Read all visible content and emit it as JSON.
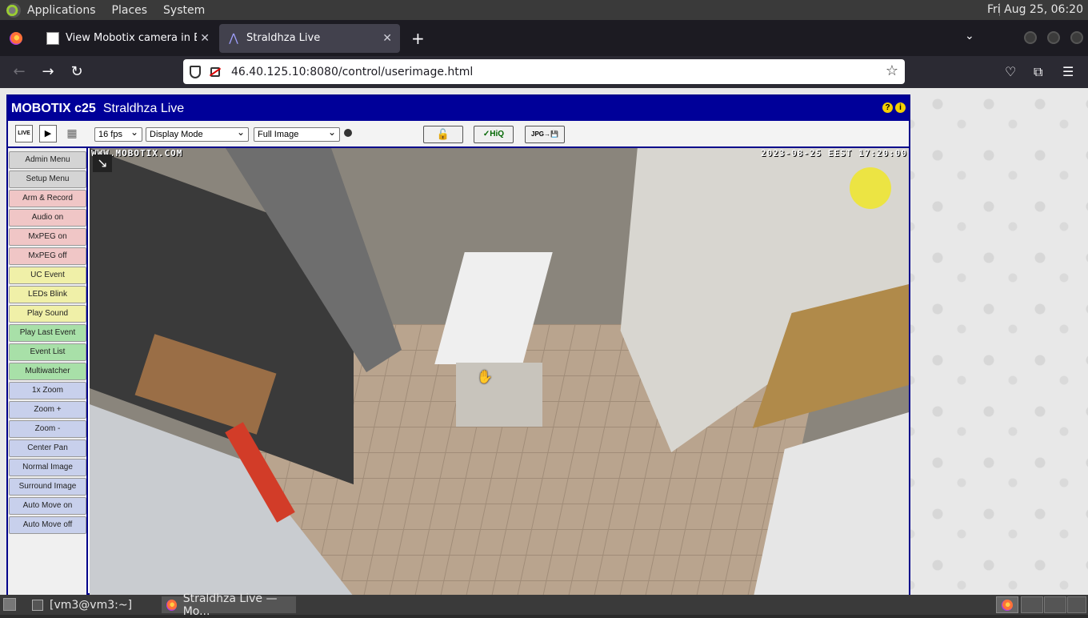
{
  "topbar": {
    "menus": [
      "Applications",
      "Places",
      "System"
    ],
    "clock": "Fri Aug 25, 06:20"
  },
  "browser": {
    "tabs": [
      {
        "label": "View Mobotix camera in Bul",
        "close": "✕"
      },
      {
        "label": "Straldhza Live",
        "close": "✕"
      }
    ],
    "new_tab": "+",
    "list_all": "⌄",
    "url": "46.40.125.10:8080/control/userimage.html",
    "star": "☆"
  },
  "mobotix": {
    "brand": "MOBOTIX c25",
    "page_title": "Straldhza Live",
    "toolbar": {
      "live": "LIVE",
      "play": "▶",
      "grid": "▦",
      "fps": "16 fps",
      "display_mode": "Display Mode",
      "image_mode": "Full Image",
      "lock": "🔓",
      "hiq": "✓HiQ",
      "save": "JPG→💾"
    },
    "sidebar": [
      {
        "label": "Admin Menu",
        "color": "gray"
      },
      {
        "label": "Setup Menu",
        "color": "gray"
      },
      {
        "label": "Arm & Record",
        "color": "pink"
      },
      {
        "label": "Audio on",
        "color": "pink"
      },
      {
        "label": "MxPEG on",
        "color": "pink"
      },
      {
        "label": "MxPEG off",
        "color": "pink"
      },
      {
        "label": "UC Event",
        "color": "yellow"
      },
      {
        "label": "LEDs Blink",
        "color": "yellow"
      },
      {
        "label": "Play Sound",
        "color": "yellow"
      },
      {
        "label": "Play Last Event",
        "color": "green"
      },
      {
        "label": "Event List",
        "color": "green"
      },
      {
        "label": "Multiwatcher",
        "color": "green"
      },
      {
        "label": "1x Zoom",
        "color": "blue"
      },
      {
        "label": "Zoom +",
        "color": "blue"
      },
      {
        "label": "Zoom -",
        "color": "blue"
      },
      {
        "label": "Center Pan",
        "color": "blue"
      },
      {
        "label": "Normal Image",
        "color": "blue"
      },
      {
        "label": "Surround Image",
        "color": "blue"
      },
      {
        "label": "Auto Move on",
        "color": "blue"
      },
      {
        "label": "Auto Move off",
        "color": "blue"
      }
    ],
    "camera": {
      "watermark": "WWW.MOBOTIX.COM",
      "timestamp": "2023-08-25 EEST 17:20:00"
    }
  },
  "taskbar": {
    "items": [
      "[vm3@vm3:~]",
      "Straldhza Live — Mo..."
    ]
  }
}
